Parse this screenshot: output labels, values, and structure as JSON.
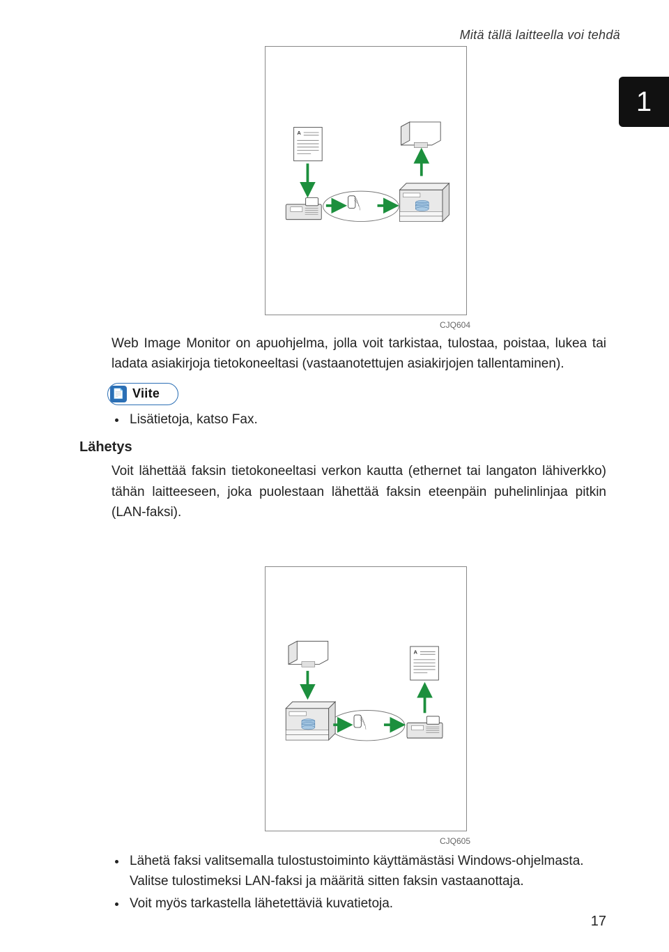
{
  "header_title": "Mitä tällä laitteella voi tehdä",
  "section_number": "1",
  "figure1_code": "CJQ604",
  "figure2_code": "CJQ605",
  "para1": "Web Image Monitor on apuohjelma, jolla voit tarkistaa, tulostaa, poistaa, lukea tai ladata asiakirjoja tietokoneeltasi (vastaanotettujen asiakirjojen tallentaminen).",
  "ref_label": "Viite",
  "ref_item": "Lisätietoja, katso Fax.",
  "send_heading": "Lähetys",
  "para2": "Voit lähettää faksin tietokoneeltasi verkon kautta (ethernet tai langaton lähiverkko) tähän laitteeseen, joka puolestaan lähettää faksin eteenpäin puhelinlinjaa pitkin (LAN-faksi).",
  "bullet1": "Lähetä faksi valitsemalla tulostustoiminto käyttämästäsi Windows-ohjelmasta. Valitse tulostimeksi LAN-faksi ja määritä sitten faksin vastaanottaja.",
  "bullet2": "Voit myös tarkastella lähetettäviä kuvatietoja.",
  "page_number": "17",
  "doc_label_A": "A"
}
